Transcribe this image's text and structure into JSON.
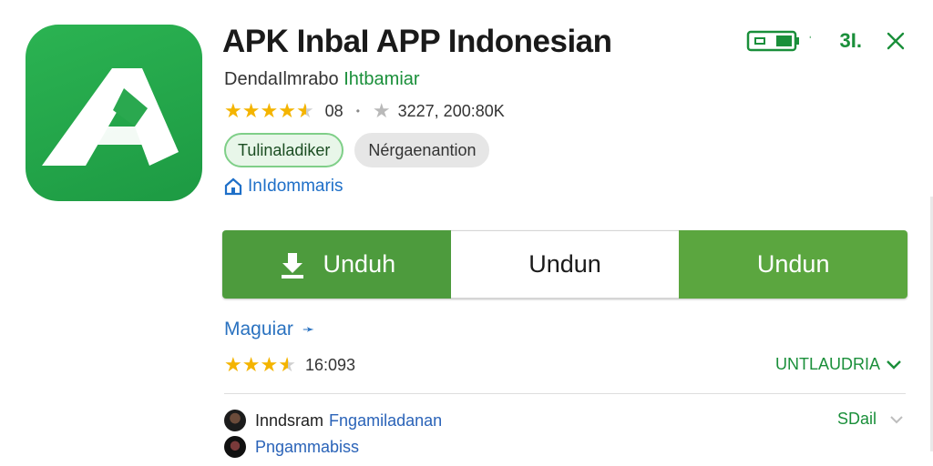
{
  "app": {
    "title": "APK InbaI APP Indonesian",
    "developer": "DendaIlmrabo",
    "developer_link": "Ihtbamiar",
    "rating": "08",
    "downloads": "3227, 200:80K",
    "chips": [
      "Tulinaladiker",
      "Nérgaenantion"
    ],
    "region": "InIdommaris",
    "icon_color": "#22a74b"
  },
  "status": {
    "signal_text": "3I.",
    "battery_icon": "battery-icon",
    "close_icon": "close-icon"
  },
  "actions": {
    "primary_label": "Unduh",
    "middle_label": "Undun",
    "secondary_label": "Undun",
    "accent": "#4d9b3d"
  },
  "reviews": {
    "more_link": "Maguiar",
    "count": "16:093",
    "sort_label": "UNTLAUDRIA"
  },
  "users": [
    {
      "name": "Inndsram",
      "sub": "Fngamiladanan",
      "action": "SDail"
    },
    {
      "name": "",
      "sub": "Pngammabiss"
    }
  ]
}
